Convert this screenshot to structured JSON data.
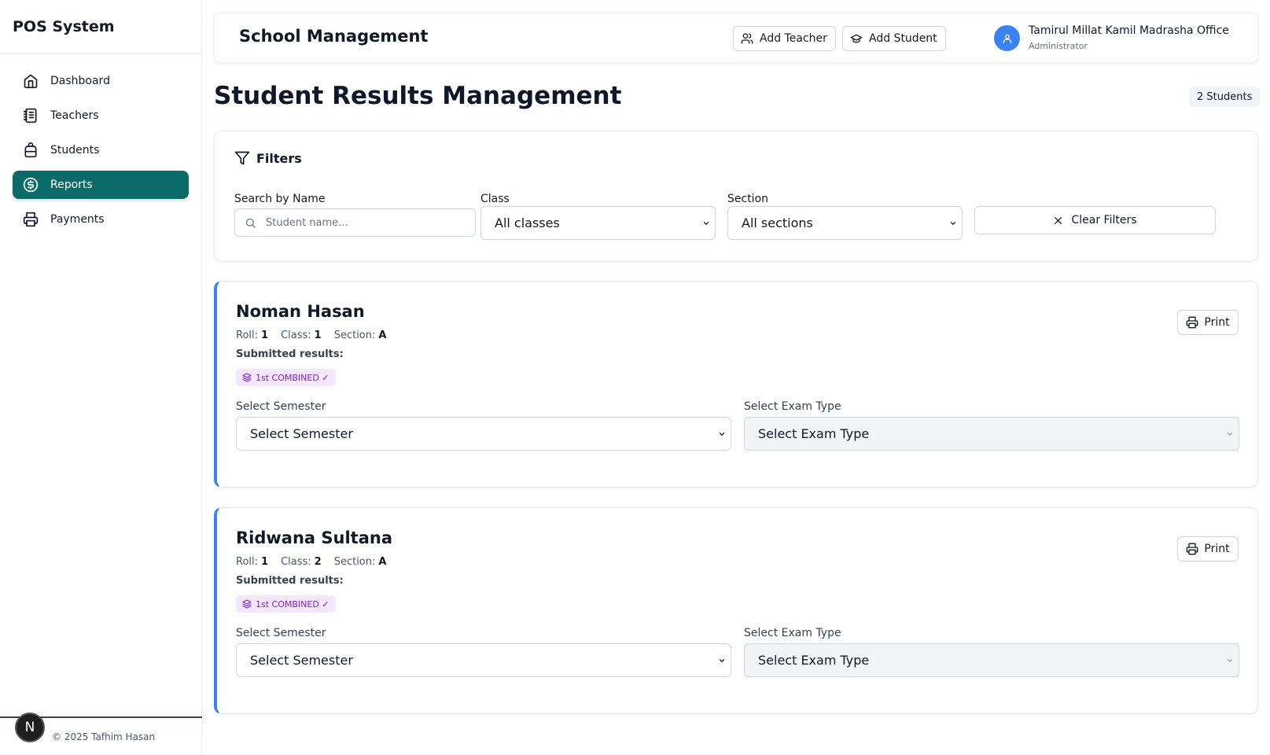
{
  "brand": "POS System",
  "nav": [
    {
      "label": "Dashboard",
      "icon": "home-icon"
    },
    {
      "label": "Teachers",
      "icon": "notebook-icon"
    },
    {
      "label": "Students",
      "icon": "backpack-icon"
    },
    {
      "label": "Reports",
      "icon": "dollar-circle-icon",
      "active": true
    },
    {
      "label": "Payments",
      "icon": "printer-icon"
    }
  ],
  "footer": {
    "copyright": "© 2025 Tafhim Hasan",
    "badge": "N"
  },
  "header": {
    "title": "School Management",
    "add_teacher": "Add Teacher",
    "add_student": "Add Student",
    "user_name": "Tamirul Millat Kamil Madrasha Office",
    "user_role": "Administrator"
  },
  "page": {
    "title": "Student Results Management",
    "count": "2 Students"
  },
  "filters": {
    "title": "Filters",
    "search_label": "Search by Name",
    "search_placeholder": "Student name...",
    "class_label": "Class",
    "class_value": "All classes",
    "section_label": "Section",
    "section_value": "All sections",
    "clear_label": "Clear Filters"
  },
  "students": [
    {
      "name": "Noman Hasan",
      "roll_label": "Roll:",
      "roll": "1",
      "class_label": "Class:",
      "class": "1",
      "section_label": "Section:",
      "section": "A",
      "submitted_label": "Submitted results:",
      "tag": "1st COMBINED ✓",
      "print_label": "Print",
      "semester_label": "Select Semester",
      "semester_value": "Select Semester",
      "exam_label": "Select Exam Type",
      "exam_value": "Select Exam Type"
    },
    {
      "name": "Ridwana Sultana",
      "roll_label": "Roll:",
      "roll": "1",
      "class_label": "Class:",
      "class": "2",
      "section_label": "Section:",
      "section": "A",
      "submitted_label": "Submitted results:",
      "tag": "1st COMBINED ✓",
      "print_label": "Print",
      "semester_label": "Select Semester",
      "semester_value": "Select Semester",
      "exam_label": "Select Exam Type",
      "exam_value": "Select Exam Type"
    }
  ],
  "colors": {
    "accent": "#0b6b68",
    "card_border": "#3b82f6",
    "tag_bg": "#f3e8ff",
    "tag_text": "#7e22ce",
    "avatar": "#3b82f6"
  }
}
